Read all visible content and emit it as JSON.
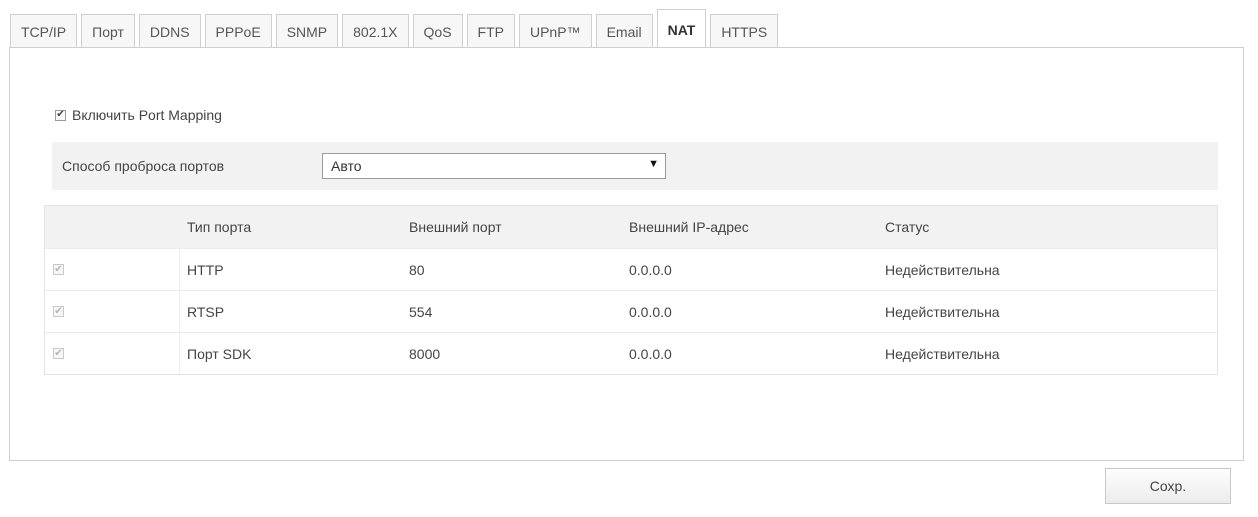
{
  "tabs": [
    {
      "label": "TCP/IP"
    },
    {
      "label": "Порт"
    },
    {
      "label": "DDNS"
    },
    {
      "label": "PPPoE"
    },
    {
      "label": "SNMP"
    },
    {
      "label": "802.1X"
    },
    {
      "label": "QoS"
    },
    {
      "label": "FTP"
    },
    {
      "label": "UPnP™"
    },
    {
      "label": "Email"
    },
    {
      "label": "NAT",
      "active": true
    },
    {
      "label": "HTTPS"
    }
  ],
  "port_mapping": {
    "enable_label": "Включить Port Mapping",
    "enabled": true,
    "mode_label": "Способ проброса портов",
    "mode_value": "Авто"
  },
  "table": {
    "headers": [
      "Тип порта",
      "Внешний порт",
      "Внешний IP-адрес",
      "Статус"
    ],
    "rows": [
      {
        "checked": true,
        "type": "HTTP",
        "port": "80",
        "ip": "0.0.0.0",
        "status": "Недействительна"
      },
      {
        "checked": true,
        "type": "RTSP",
        "port": "554",
        "ip": "0.0.0.0",
        "status": "Недействительна"
      },
      {
        "checked": true,
        "type": "Порт SDK",
        "port": "8000",
        "ip": "0.0.0.0",
        "status": "Недействительна"
      }
    ]
  },
  "actions": {
    "save_label": "Сохр."
  },
  "icons": {
    "check": "check-icon",
    "dropdown": "dropdown-arrow-icon"
  }
}
